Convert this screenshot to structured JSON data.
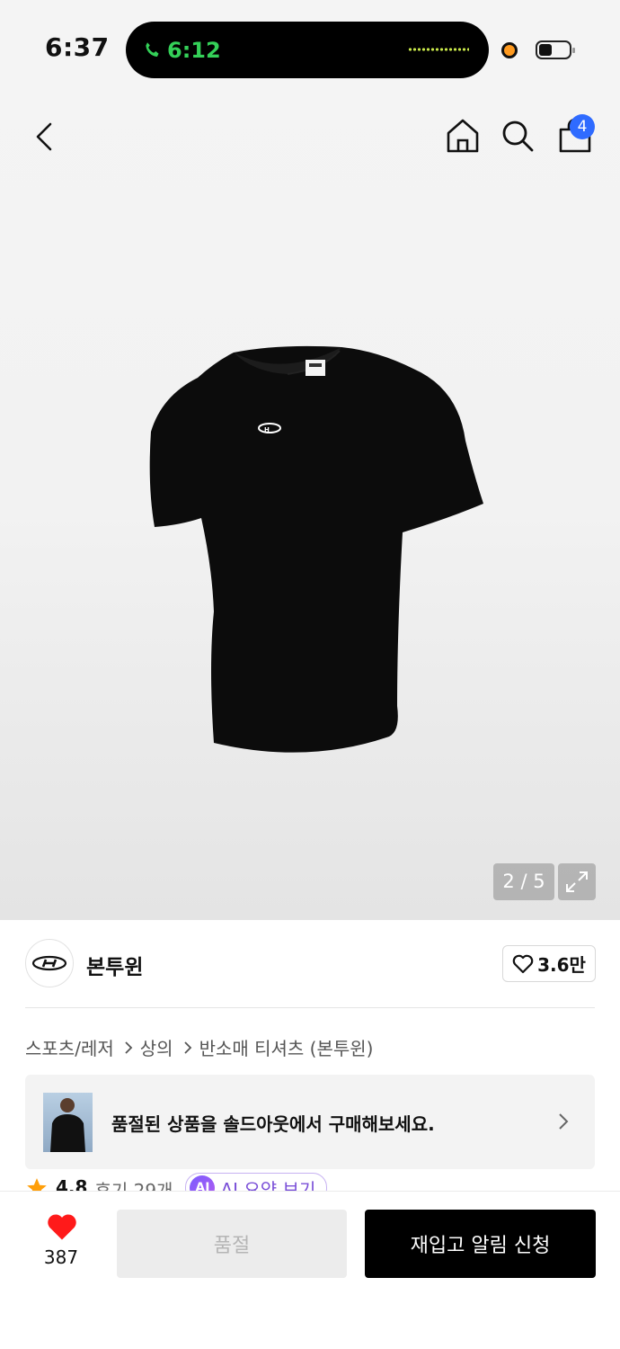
{
  "status_bar": {
    "time": "6:37",
    "call_timer": "6:12"
  },
  "header": {
    "cart_count": "4"
  },
  "gallery": {
    "indicator": "2 / 5"
  },
  "brand": {
    "name": "본투윈",
    "likes": "3.6만"
  },
  "breadcrumb": [
    "스포츠/레저",
    "상의",
    "반소매 티셔츠 (본투윈)"
  ],
  "soldout_banner": {
    "text": "품절된 상품을 솔드아웃에서 구매해보세요."
  },
  "rating": {
    "score": "4.8",
    "reviews": "후기 29개",
    "ai_badge_icon": "AI",
    "ai_summary": "AI 요약 보기"
  },
  "bottom_bar": {
    "heart_count": "387",
    "soldout_label": "품절",
    "restock_label": "재입고 알림 신청"
  },
  "colors": {
    "accent_badge": "#2f6bff",
    "heart": "#ff1a1a",
    "call_green": "#34d058",
    "ai_purple": "#7a4fd8"
  }
}
